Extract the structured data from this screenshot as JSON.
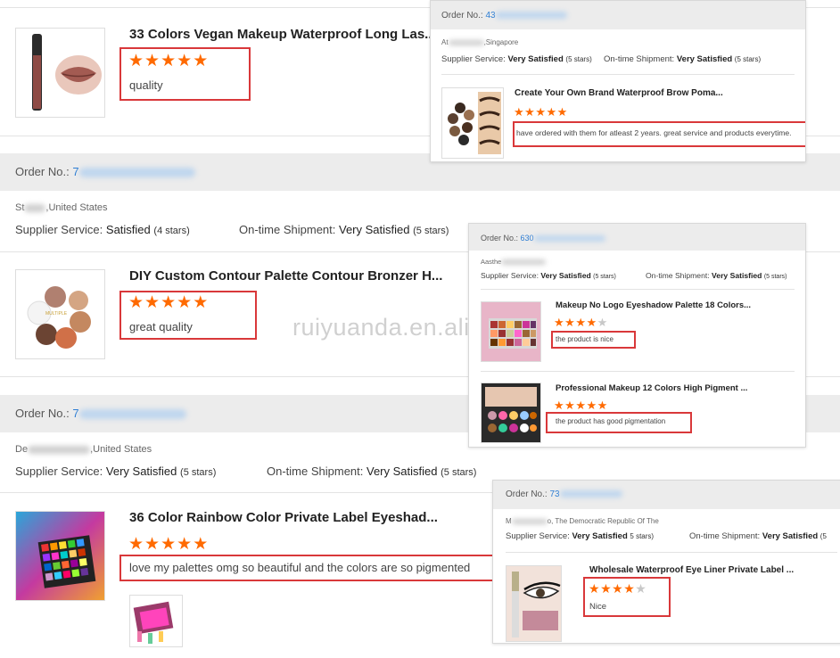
{
  "watermark": "ruiyuanda.en.alibaba.com",
  "left": {
    "review1": {
      "title": "33 Colors Vegan Makeup Waterproof Long Las...",
      "stars": 5,
      "comment": "quality"
    },
    "order2": {
      "label": "Order No.:",
      "prefix": "7",
      "location": "St",
      "location_suffix": ",United States",
      "supplier_label": "Supplier Service:",
      "supplier_value": "Satisfied",
      "supplier_stars": "(4 stars)",
      "shipment_label": "On-time Shipment:",
      "shipment_value": "Very Satisfied",
      "shipment_stars": "(5 stars)"
    },
    "review2": {
      "title": "DIY Custom Contour Palette Contour Bronzer H...",
      "stars": 5,
      "comment": "great quality"
    },
    "order3": {
      "label": "Order No.:",
      "prefix": "7",
      "location": "De",
      "location_suffix": ",United States",
      "supplier_label": "Supplier Service:",
      "supplier_value": "Very Satisfied",
      "supplier_stars": "(5 stars)",
      "shipment_label": "On-time Shipment:",
      "shipment_value": "Very Satisfied",
      "shipment_stars": "(5 stars)"
    },
    "review3": {
      "title": "36 Color Rainbow Color Private Label Eyeshad...",
      "stars": 5,
      "comment": "love my palettes omg so beautiful and the colors are so pigmented"
    }
  },
  "card1": {
    "order_label": "Order No.:",
    "order_prefix": "43",
    "location": "At",
    "location_suffix": ",Singapore",
    "supplier_label": "Supplier Service:",
    "supplier_value": "Very Satisfied",
    "supplier_stars": "(5 stars)",
    "shipment_label": "On-time Shipment:",
    "shipment_value": "Very Satisfied",
    "shipment_stars": "(5 stars)",
    "title": "Create Your Own Brand Waterproof Brow Poma...",
    "stars": 5,
    "comment": "have ordered with them for atleast 2 years. great service and products everytime."
  },
  "card2": {
    "order_label": "Order No.:",
    "order_prefix": "630",
    "location": "Aasthe",
    "supplier_label": "Supplier Service:",
    "supplier_value": "Very Satisfied",
    "supplier_stars": "(5 stars)",
    "shipment_label": "On-time Shipment:",
    "shipment_value": "Very Satisfied",
    "shipment_stars": "(5 stars)",
    "item1": {
      "title": "Makeup No Logo Eyeshadow Palette 18 Colors...",
      "stars": 4,
      "comment": "the product is nice"
    },
    "item2": {
      "title": "Professional Makeup 12 Colors High Pigment ...",
      "stars": 5,
      "comment": "the product has good pigmentation"
    }
  },
  "card3": {
    "order_label": "Order No.:",
    "order_prefix": "73",
    "location": "M",
    "location_suffix": "o, The Democratic Republic Of The",
    "supplier_label": "Supplier Service:",
    "supplier_value": "Very Satisfied",
    "supplier_stars": "5 stars)",
    "shipment_label": "On-time Shipment:",
    "shipment_value": "Very Satisfied",
    "shipment_stars": "(5",
    "title": "Wholesale Waterproof Eye Liner Private Label ...",
    "stars": 4,
    "comment": "Nice"
  },
  "colors": {
    "accent_star": "#ff6a00",
    "box_red": "#d9383a",
    "order_link": "#2b7cd3"
  },
  "icons": {
    "star": "star-icon"
  }
}
